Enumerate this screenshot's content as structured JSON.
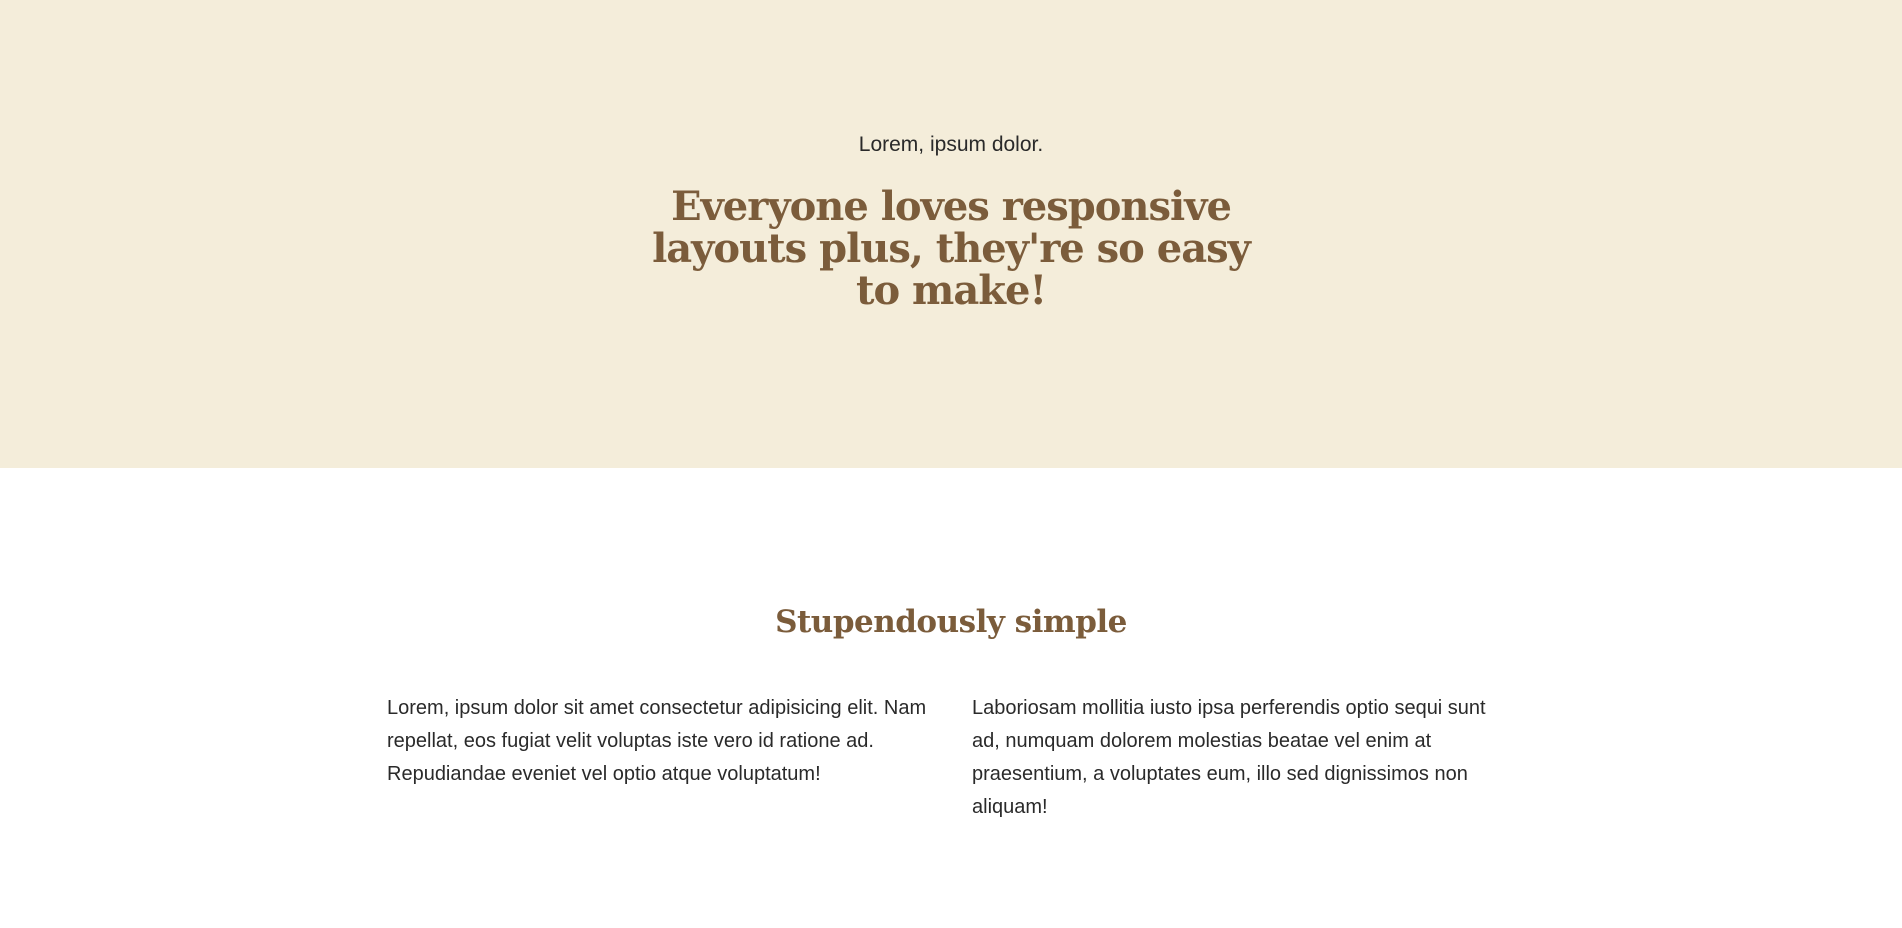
{
  "hero": {
    "eyebrow": "Lorem, ipsum dolor.",
    "title": "Everyone loves responsive layouts plus, they're so easy to make!",
    "background_color": "#f4edda",
    "title_color": "#7b5c3b"
  },
  "features": {
    "title": "Stupendously simple",
    "columns": [
      {
        "text": "Lorem, ipsum dolor sit amet consectetur adipisicing elit. Nam repellat, eos fugiat velit voluptas iste vero id ratione ad. Repudiandae eveniet vel optio atque voluptatum!"
      },
      {
        "text": "Laboriosam mollitia iusto ipsa perferendis optio sequi sunt ad, numquam dolorem molestias beatae vel enim at praesentium, a voluptates eum, illo sed dignissimos non aliquam!"
      }
    ]
  }
}
